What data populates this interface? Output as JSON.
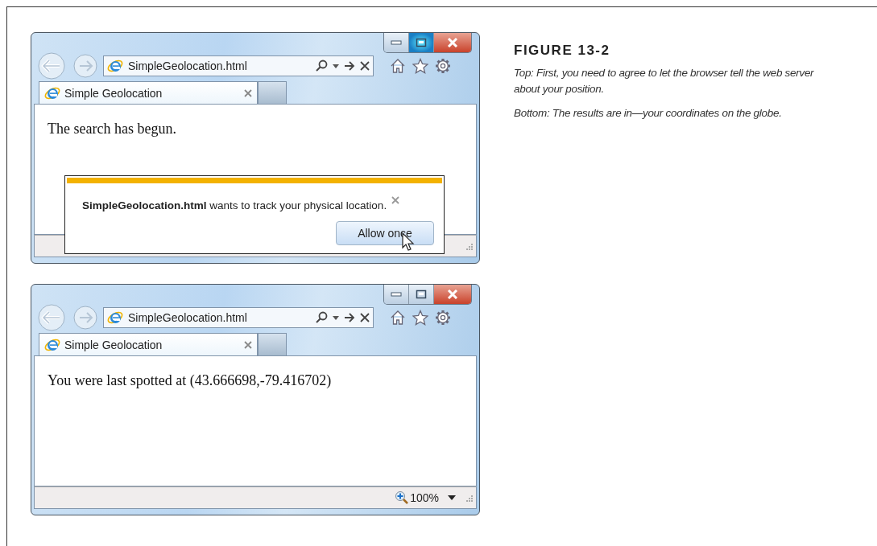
{
  "windows": [
    {
      "address": "SimpleGeolocation.html",
      "tab_title": "Simple Geolocation",
      "maximize_hover": true,
      "content_text": "The search has begun.",
      "notification": {
        "message": "**SimpleGeolocation.html** wants to track your physical location.",
        "button": "Allow once"
      }
    },
    {
      "address": "SimpleGeolocation.html",
      "tab_title": "Simple Geolocation",
      "maximize_hover": false,
      "content_text": "You were last spotted at (43.666698,-79.416702)",
      "status_zoom": "100%"
    }
  ],
  "caption": {
    "figure_label": "FIGURE 13-2",
    "paragraphs": [
      "Top: First, you need to agree to let the browser tell the web server about your position.",
      "Bottom: The results are in—your coordinates on the globe."
    ]
  }
}
